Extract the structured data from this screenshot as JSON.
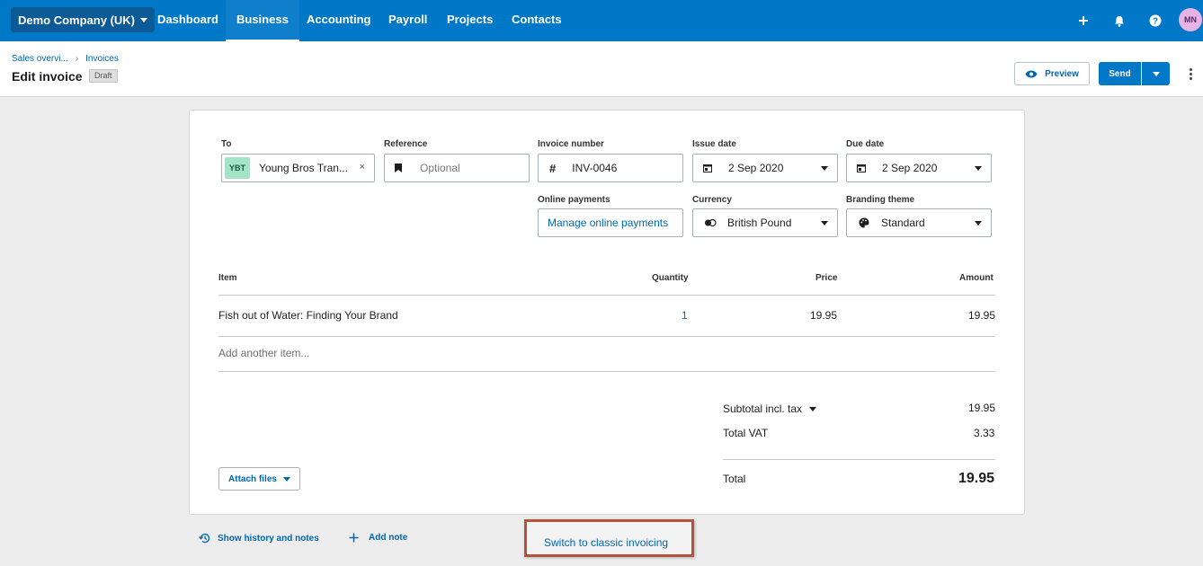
{
  "nav": {
    "org": "Demo Company (UK)",
    "items": [
      "Dashboard",
      "Business",
      "Accounting",
      "Payroll",
      "Projects",
      "Contacts"
    ],
    "active": "Business",
    "avatar": "MN",
    "icons": [
      "plus-icon",
      "bell-icon",
      "help-icon"
    ]
  },
  "header": {
    "breadcrumb": [
      "Sales overvi...",
      "Invoices"
    ],
    "title": "Edit invoice",
    "status": "Draft",
    "preview_label": "Preview",
    "send_label": "Send"
  },
  "form": {
    "to_label": "To",
    "contact_initials": "YBT",
    "contact_name": "Young Bros Tran...",
    "reference_label": "Reference",
    "reference_placeholder": "Optional",
    "invoice_number_label": "Invoice number",
    "invoice_number": "INV-0046",
    "issue_date_label": "Issue date",
    "issue_date": "2 Sep 2020",
    "due_date_label": "Due date",
    "due_date": "2 Sep 2020",
    "online_payments_label": "Online payments",
    "online_payments_link": "Manage online payments",
    "currency_label": "Currency",
    "currency": "British Pound",
    "branding_label": "Branding theme",
    "branding": "Standard"
  },
  "table": {
    "columns": [
      "Item",
      "Quantity",
      "Price",
      "Amount"
    ],
    "rows": [
      {
        "item": "Fish out of Water: Finding Your Brand",
        "quantity": "1",
        "price": "19.95",
        "amount": "19.95"
      }
    ],
    "add_placeholder": "Add another item..."
  },
  "totals": {
    "subtotal_label": "Subtotal incl. tax",
    "subtotal": "19.95",
    "vat_label": "Total VAT",
    "vat": "3.33",
    "total_label": "Total",
    "total": "19.95"
  },
  "footer": {
    "attach_label": "Attach files",
    "history_label": "Show history and notes",
    "add_note_label": "Add note",
    "classic_label": "Switch to classic invoicing"
  }
}
